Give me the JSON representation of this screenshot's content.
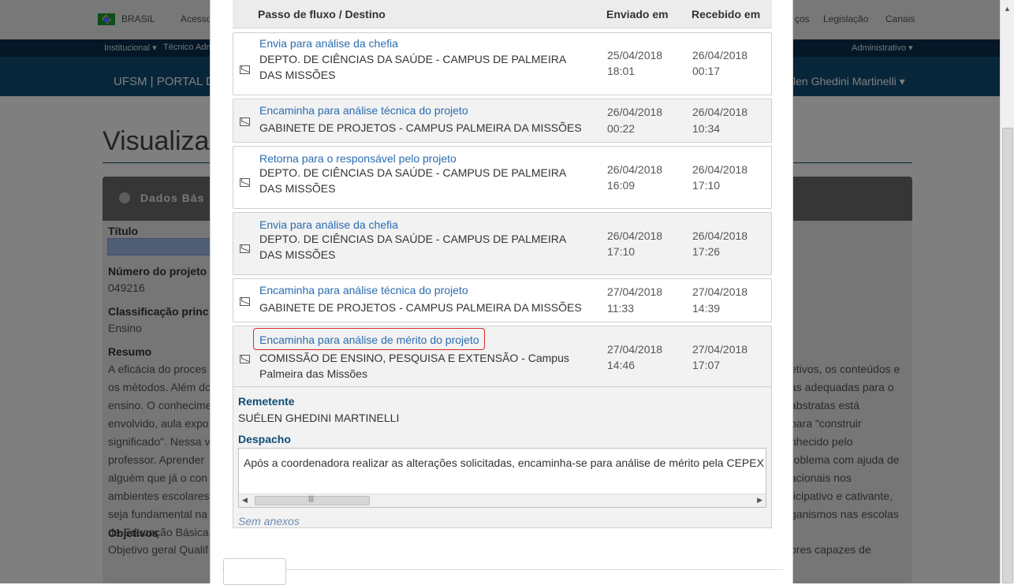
{
  "background": {
    "gov_bar": {
      "country": "BRASIL",
      "access": "Acesso",
      "right_items": [
        "ços",
        "Legislação",
        "Canais"
      ]
    },
    "nav_bar": {
      "left_items": [
        "Institucional ▾",
        "Técnico Adm"
      ],
      "right_item": "Administrativo ▾"
    },
    "portal_bar": {
      "title": "UFSM | PORTAL D",
      "user": "len Ghedini Martinelli ▾"
    },
    "page_title": "Visualizar p",
    "panel_title": "Dados Bás",
    "fields": {
      "titulo_label": "Título",
      "numero_label": "Número do projeto",
      "numero_value": "049216",
      "classificacao_label": "Classificação princ",
      "classificacao_value": "Ensino",
      "resumo_label": "Resumo",
      "resumo_left": [
        "A eficácia do proces",
        "os métodos. Além do",
        "ensino. O conhecime",
        "envolvido, aula expo",
        "significado\". Nessa v",
        "professor. Aprender",
        "alguém que já o con",
        "ambientes escolares",
        "seja fundamental na",
        "de Educação Básica"
      ],
      "resumo_right": [
        "etivos, os conteúdos e",
        "as adequadas para o",
        "abstratas está",
        "para \"construir",
        "nhecido pelo",
        "roblema com ajuda de",
        "acionais nos",
        "ticipativo e cativante,",
        "ganismos nas escolas"
      ],
      "objetivos_label": "Objetivos",
      "objetivos_left": "Objetivo geral Qualif",
      "objetivos_right": "ores capazes de"
    }
  },
  "modal": {
    "headers": {
      "step": "Passo de fluxo / Destino",
      "sent": "Enviado em",
      "received": "Recebido em"
    },
    "rows": [
      {
        "step": "Envia para análise da chefia",
        "dest": "DEPTO. DE CIÊNCIAS DA SAÚDE - CAMPUS DE PALMEIRA DAS MISSÕES",
        "sent_date": "25/04/2018",
        "sent_time": "18:01",
        "recv_date": "26/04/2018",
        "recv_time": "00:17"
      },
      {
        "step": "Encaminha para análise técnica do projeto",
        "dest": "GABINETE DE PROJETOS - CAMPUS PALMEIRA DA MISSÕES",
        "sent_date": "26/04/2018",
        "sent_time": "00:22",
        "recv_date": "26/04/2018",
        "recv_time": "10:34"
      },
      {
        "step": "Retorna para o responsável pelo projeto",
        "dest": "DEPTO. DE CIÊNCIAS DA SAÚDE - CAMPUS DE PALMEIRA DAS MISSÕES",
        "sent_date": "26/04/2018",
        "sent_time": "16:09",
        "recv_date": "26/04/2018",
        "recv_time": "17:10"
      },
      {
        "step": "Envia para análise da chefia",
        "dest": "DEPTO. DE CIÊNCIAS DA SAÚDE - CAMPUS DE PALMEIRA DAS MISSÕES",
        "sent_date": "26/04/2018",
        "sent_time": "17:10",
        "recv_date": "26/04/2018",
        "recv_time": "17:26"
      },
      {
        "step": "Encaminha para análise técnica do projeto",
        "dest": "GABINETE DE PROJETOS - CAMPUS PALMEIRA DA MISSÕES",
        "sent_date": "27/04/2018",
        "sent_time": "11:33",
        "recv_date": "27/04/2018",
        "recv_time": "14:39"
      },
      {
        "step": "Encaminha para análise de mérito do projeto",
        "dest": "COMISSÃO DE ENSINO, PESQUISA E EXTENSÃO - Campus Palmeira das Missões",
        "sent_date": "27/04/2018",
        "sent_time": "14:46",
        "recv_date": "27/04/2018",
        "recv_time": "17:07"
      }
    ],
    "detail": {
      "remetente_label": "Remetente",
      "remetente_value": "SUÉLEN GHEDINI MARTINELLI",
      "despacho_label": "Despacho",
      "despacho_text": "Após a coordenadora realizar as alterações solicitadas, encaminha-se para análise de mérito pela CEPEX e veri",
      "no_attachments": "Sem anexos"
    }
  },
  "colors": {
    "link": "#2b6cb0",
    "highlight": "#d62b2b",
    "portal": "#0f4c75"
  }
}
